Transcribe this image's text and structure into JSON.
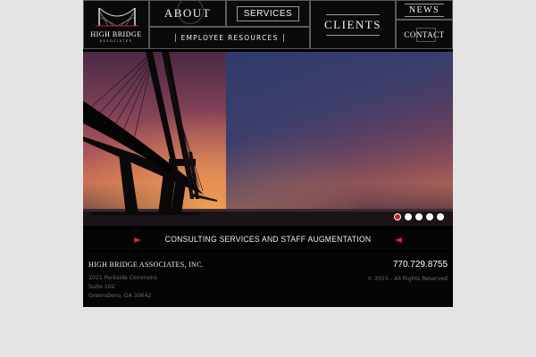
{
  "logo": {
    "name": "HIGH BRIDGE",
    "sub": "ASSOCIATES"
  },
  "nav": {
    "about": "ABOUT",
    "services": "SERVICES",
    "employee": "EMPLOYEE RESOURCES",
    "clients": "CLIENTS",
    "news": "NEWS",
    "contact": "CONTACT"
  },
  "slider": {
    "slide_count": 5,
    "active_index": 0
  },
  "tagline": "CONSULTING SERVICES AND STAFF AUGMENTATION",
  "footer": {
    "company": "HIGH BRIDGE ASSOCIATES, INC.",
    "address_lines": [
      "1021 Parkside Commons",
      "Suite 102",
      "Greensboro, GA 30642"
    ],
    "phone": "770.729.8755",
    "copyright": "© 2015 - All Rights Reserved"
  },
  "colors": {
    "accent": "#d42a23",
    "background": "#e4e4e4",
    "panel": "#000000"
  }
}
